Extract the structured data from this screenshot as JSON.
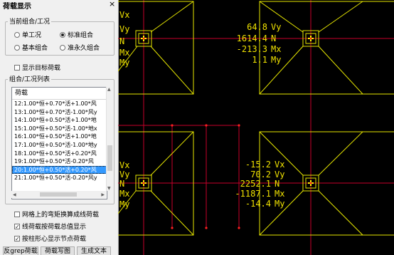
{
  "panel": {
    "title": "荷载显示",
    "close": "×",
    "combo_group": {
      "title": "当前组合/工况",
      "radios": [
        {
          "label": "单工况",
          "selected": false
        },
        {
          "label": "标准组合",
          "selected": true
        },
        {
          "label": "基本组合",
          "selected": false
        },
        {
          "label": "准永久组合",
          "selected": false
        }
      ]
    },
    "show_target_label": "显示目标荷载",
    "list_group_title": "组合/工况列表",
    "list": {
      "header": "荷载",
      "rows": [
        "12:1.00*恒+0.70*活+1.00*风",
        "13:1.00*恒+0.70*活-1.00*风y",
        "14:1.00*恒+0.50*活+1.00*地",
        "15:1.00*恒+0.50*活-1.00*地x",
        "16:1.00*恒+0.50*活+1.00*地",
        "17:1.00*恒+0.50*活-1.00*地y",
        "18:1.00*恒+0.50*活+0.20*风",
        "19:1.00*恒+0.50*活-0.20*风",
        "20:1.00*恒+0.50*活+0.20*风",
        "21:1.00*恒+0.50*活-0.20*风y"
      ],
      "selected_index": 8
    },
    "checks": [
      {
        "label": "网格上的弯矩换算成线荷载",
        "checked": false
      },
      {
        "label": "线荷载按荷载总值显示",
        "checked": true
      },
      {
        "label": "按柱形心显示节点荷载",
        "checked": true
      }
    ],
    "buttons": [
      "反grep荷载",
      "荷载写图",
      "生成文本"
    ]
  },
  "canvas": {
    "colors": {
      "frame": "#e6e600",
      "grid": "#c8002a",
      "text": "#ffffff",
      "marker": "#ffff00",
      "node": "#ff2020"
    },
    "top_left_labels": [
      "Vx",
      "Vy",
      "N",
      "Mx",
      "My"
    ],
    "top_right_values": [
      {
        "value": "64.8",
        "unit": "Vy"
      },
      {
        "value": "1614.4",
        "unit": "N"
      },
      {
        "value": "-213.3",
        "unit": "Mx"
      },
      {
        "value": "1.1",
        "unit": "My"
      }
    ],
    "bottom_left_labels": [
      "Vx",
      "Vy",
      "N",
      "Mx",
      "My"
    ],
    "bottom_right_values": [
      {
        "value": "-15.2",
        "unit": "Vx"
      },
      {
        "value": "70.2",
        "unit": "Vy"
      },
      {
        "value": "2252.1",
        "unit": "N"
      },
      {
        "value": "-1187.1",
        "unit": "Mx"
      },
      {
        "value": "-14.4",
        "unit": "My"
      }
    ]
  }
}
